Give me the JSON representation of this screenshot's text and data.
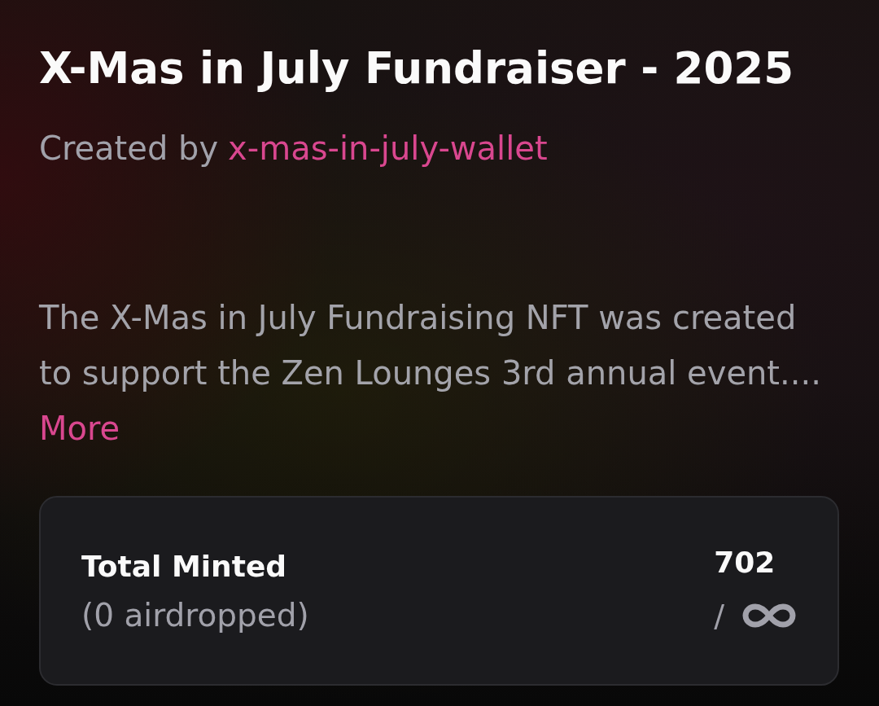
{
  "header": {
    "title": "X-Mas in July Fundraiser - 2025",
    "creator": {
      "prefix": "Created by",
      "name": "x-mas-in-july-wallet"
    }
  },
  "description": {
    "text": "The X-Mas in July Fundraising NFT was created to support the Zen Lounges 3rd annual event....",
    "more_link": "More"
  },
  "stats_card": {
    "label": "Total Minted",
    "sublabel": "(0 airdropped)",
    "value": "702",
    "separator": "/"
  }
}
